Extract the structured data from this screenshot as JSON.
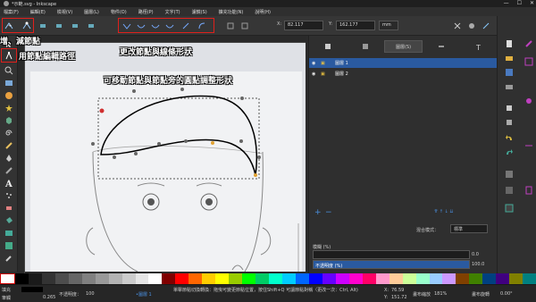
{
  "window": {
    "title": "*示範.svg - Inkscape",
    "controls": [
      "—",
      "☐",
      "✕"
    ]
  },
  "menu": [
    "檔案(F)",
    "編輯(E)",
    "檢視(V)",
    "圖層(L)",
    "物件(O)",
    "路徑(P)",
    "文字(T)",
    "濾鏡(S)",
    "擴充功能(N)",
    "說明(H)"
  ],
  "toolbar": {
    "x_label": "X:",
    "x_value": "82.117",
    "y_label": "Y:",
    "y_value": "162.177",
    "unit": "mm"
  },
  "annotations": {
    "add_remove_nodes": "增、減節點",
    "change_shape": "更改節點與線條形狀",
    "node_tool": "用節點編輯路徑",
    "drag_nodes": "可移動節點與節點旁的圓點調整形狀"
  },
  "panel": {
    "tab_label": "圖層(S)",
    "layers": [
      {
        "name": "圖層 1",
        "selected": true
      },
      {
        "name": "圖層 2",
        "selected": false
      }
    ],
    "add": "+",
    "remove": "−",
    "blend_label": "混合模式：",
    "blend_value": "標準",
    "blur_label": "模糊 (%)",
    "blur_value": "0.0",
    "opacity_label": "不透明度 (%)",
    "opacity_value": "100.0"
  },
  "status": {
    "fill_label": "填充",
    "stroke_label": "筆觸",
    "stroke_width": "0.265",
    "opacity_label": "不透明度：",
    "opacity_value": "100",
    "layer_select": "•圖層 1",
    "message": "單擊節點切換轉換：拖曳可變更節點位置，按住Shift+Q 可讓節點對稱（更改一次：Ctrl, Alt)",
    "x_label": "X:",
    "x": "76.59",
    "y_label": "Y:",
    "y": "151.72",
    "zoom_label": "畫布縮放",
    "zoom": "181%",
    "rotate_label": "畫布旋轉",
    "rotate": "0.00°"
  },
  "colors": {
    "accent": "#e0201c",
    "selection": "#2a5aa0",
    "opacity_bar": "#2a5aa0"
  }
}
